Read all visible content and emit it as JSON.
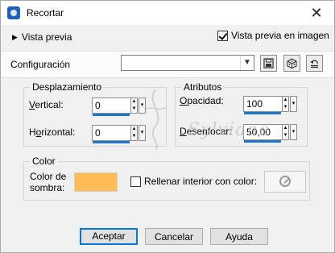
{
  "window": {
    "title": "Recortar",
    "close_glyph": "✕"
  },
  "preview": {
    "toggle_label": "Vista previa",
    "checkbox_label": "Vista previa en imagen",
    "checked": true
  },
  "config": {
    "label": "Configuración",
    "value": "",
    "icons": [
      "save-icon",
      "dice-icon",
      "reset-icon"
    ]
  },
  "desplazamiento": {
    "title": "Desplazamiento",
    "vertical_label": "Vertical:",
    "vertical_value": "0",
    "horizontal_label": "Horizontal:",
    "horizontal_value": "0"
  },
  "atributos": {
    "title": "Atributos",
    "opacidad_label": "Opacidad:",
    "opacidad_value": "100",
    "desenfocar_label": "Desenfocar:",
    "desenfocar_value": "50,00"
  },
  "color_group": {
    "title": "Color",
    "shadow_label_line1": "Color de",
    "shadow_label_line2": "sombra:",
    "shadow_color": "#ffbb55",
    "fill_label": "Rellenar interior con color:",
    "fill_checked": false
  },
  "watermark": "Sylviane",
  "buttons": {
    "ok": "Aceptar",
    "cancel": "Cancelar",
    "help": "Ayuda"
  }
}
